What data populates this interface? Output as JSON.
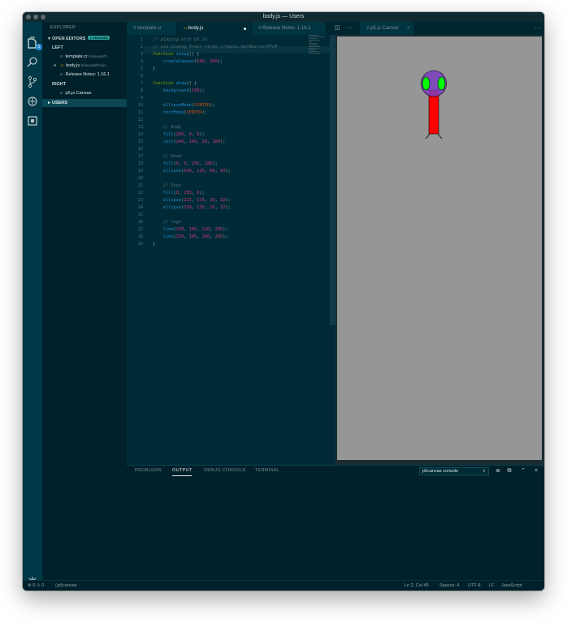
{
  "window": {
    "title": "body.js — Users"
  },
  "activity_bar": {
    "explorer_badge": "1",
    "icons": [
      "files-icon",
      "search-icon",
      "source-control-icon",
      "debug-icon",
      "extensions-icon",
      "settings-icon"
    ]
  },
  "sidebar": {
    "title": "EXPLORER",
    "open_editors": {
      "label": "OPEN EDITORS",
      "badge": "1 UNSAVED",
      "groups": [
        {
          "label": "LEFT",
          "files": [
            {
              "name": "template.cr",
              "path": "brianwatt/P..."
            },
            {
              "name": "body.js",
              "path": "brianwatt/Proje...",
              "dirty": true
            },
            {
              "name": "Release Notes: 1.16.1",
              "path": ""
            }
          ]
        },
        {
          "label": "RIGHT",
          "files": [
            {
              "name": "p5.js Canvas",
              "path": ""
            }
          ]
        }
      ]
    },
    "users_label": "USERS"
  },
  "tabs": [
    {
      "label": "template.cr",
      "active": false
    },
    {
      "label": "body.js",
      "active": true,
      "dirty": true
    },
    {
      "label": "Release Notes: 1.16.1",
      "active": false
    },
    {
      "label": "p5.js Canvas",
      "active": false
    }
  ],
  "editor": {
    "line_numbers": [
      "1",
      "2",
      "3",
      "4",
      "5",
      "6",
      "7",
      "8",
      "9",
      "10",
      "11",
      "12",
      "13",
      "14",
      "15",
      "16",
      "17",
      "18",
      "19",
      "20",
      "21",
      "22",
      "23",
      "24",
      "25",
      "26",
      "27",
      "28",
      "29"
    ]
  },
  "panel": {
    "tabs": [
      "PROBLEMS",
      "OUTPUT",
      "DEBUG CONSOLE",
      "TERMINAL"
    ],
    "active_tab": "OUTPUT",
    "output_channel": "p5canvas console"
  },
  "statusbar": {
    "errors": "0",
    "warnings": "0",
    "project": "p5canvas",
    "cursor": "Ln 2, Col 45",
    "spaces": "Spaces: 4",
    "encoding": "UTF-8",
    "eol": "LF",
    "language": "JavaScript"
  },
  "colors": {
    "editor_bg": "#002b36",
    "sidebar_bg": "#00212b",
    "canvas_bg": "#969696",
    "body_fill": "#fa0000",
    "head_fill": "#0000ff",
    "eye_fill": "#00ff00"
  }
}
